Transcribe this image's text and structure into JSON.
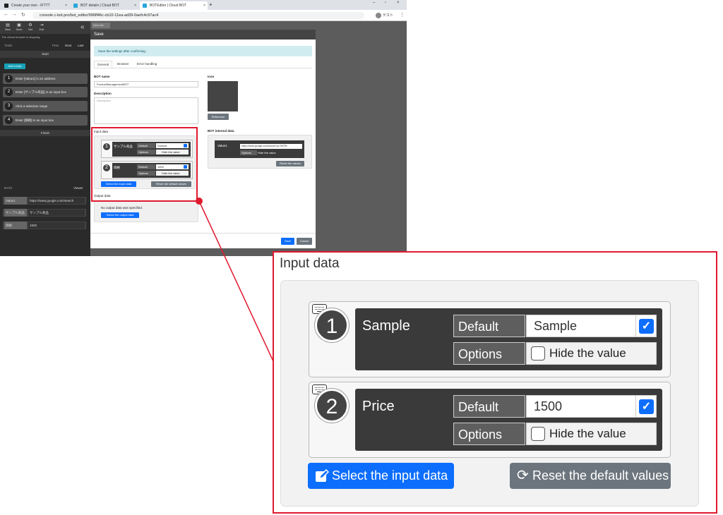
{
  "browser": {
    "tabs": [
      {
        "label": "Create your own - IFTTT",
        "active": false
      },
      {
        "label": "BOT details | Cloud BOT",
        "active": false
      },
      {
        "label": "BOTEditor | Cloud BOT",
        "active": true
      }
    ],
    "new_tab": "+",
    "url": "console.c-bot.pro/bot_editor/996ff46c-cb10-11ea-ad39-0aefc4c97ac4",
    "profile": "ゲスト"
  },
  "sidebar": {
    "tools": [
      "New",
      "Save",
      "Set",
      "Exit"
    ],
    "collapse": "«",
    "warning": "The virtual browser is stopping.",
    "task_section": "TASK",
    "task_nav": [
      "Prev",
      "Next",
      "Last"
    ],
    "start": "Start",
    "add_task": "Add a task",
    "steps": [
      "Enter [Value1] in an address",
      "Enter [サンプル商品] in an input box",
      "Click a selection range",
      "Enter [価格] in an input box"
    ],
    "finish": "Finish",
    "data_section": "DATA",
    "viewer": "Viewer",
    "data_rows": [
      {
        "key": "Value1",
        "value": "https://www.google.com/search"
      },
      {
        "key": "サンプル商品",
        "value": "サンプル商品"
      },
      {
        "key": "価格",
        "value": "1500"
      }
    ]
  },
  "workspace_tab": "New tab",
  "modal": {
    "title": "Save",
    "alert": "Save the settings after confirming.",
    "tabs": [
      "General",
      "Browser",
      "Error handling"
    ],
    "bot_name_label": "BOT name",
    "bot_name_value": "ProductManagementBOT",
    "description_label": "Description",
    "description_placeholder": "Description",
    "icon_label": "Icon",
    "reference_button": "Reference",
    "input_data_label": "Input data",
    "bot_internal_label": "BOT internal data",
    "internal_key": "Value1",
    "internal_value": "https://www.google.com/search?q=%E3%",
    "internal_options": "Options",
    "internal_hide": "Hide the value",
    "reset_values": "Reset the values",
    "small_inputs": [
      {
        "name": "サンプル商品",
        "default": "Sample"
      },
      {
        "name": "価格",
        "default": "1500"
      }
    ],
    "output_data_label": "Output data",
    "no_output": "No output data was specified.",
    "select_output": "Select the output data",
    "save_button": "Save",
    "cancel_button": "Cancel"
  },
  "zoom": {
    "title": "Input data",
    "default_label": "Default",
    "options_label": "Options",
    "hide_value": "Hide the value",
    "checkmark": "✓",
    "inputs": [
      {
        "num": "1",
        "name": "Sample",
        "default": "Sample"
      },
      {
        "num": "2",
        "name": "Price",
        "default": "1500"
      }
    ],
    "select_input": "Select the input data",
    "reset_defaults": "Reset the default values"
  },
  "colors": {
    "primary": "#0d6efd",
    "secondary": "#6c757d",
    "highlight": "#e0192f",
    "info_bg": "#d1ecf1"
  }
}
